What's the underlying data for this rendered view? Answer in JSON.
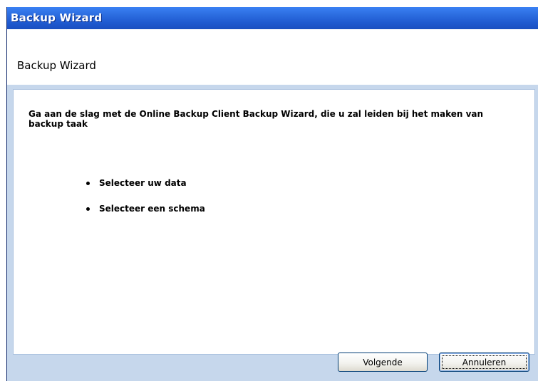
{
  "window": {
    "title": "Backup Wizard"
  },
  "header": {
    "title": "Backup Wizard"
  },
  "content": {
    "intro": "Ga aan de slag met de Online Backup Client Backup Wizard, die u zal leiden bij het maken van backup taak",
    "steps": [
      "Selecteer uw data",
      "Selecteer een schema"
    ]
  },
  "buttons": {
    "next": "Volgende",
    "cancel": "Annuleren"
  }
}
